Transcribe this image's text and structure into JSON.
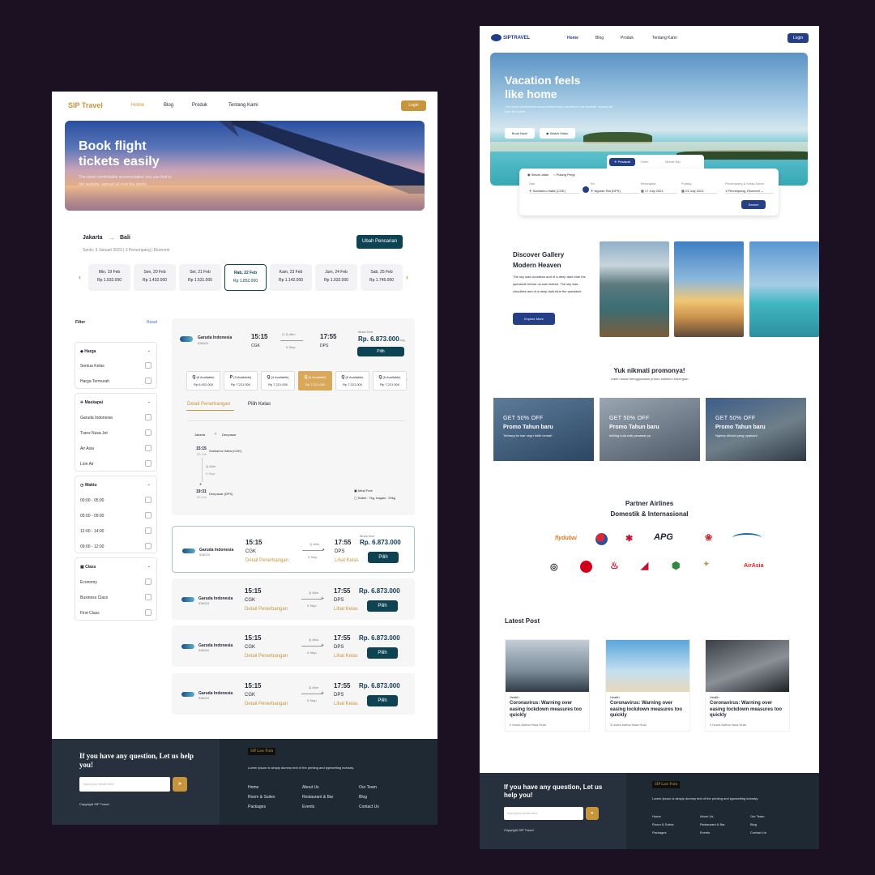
{
  "left": {
    "brand": "SIP Travel",
    "nav": [
      "Home",
      "Blog",
      "Produk",
      "Tentang Kami"
    ],
    "login": "Login",
    "hero_title_1": "Book flight",
    "hero_title_2": "tickets easily",
    "hero_sub_1": "The most comfortable accomodation you can find in",
    "hero_sub_2": "our website, spread all over the world.",
    "route_from": "Jakarta",
    "route_to": "Bali",
    "route_meta": "Senin, 9 Januari 2023  |  3 Penumpang  |  Ekonomi",
    "change_search": "Ubah Pencarian",
    "dates": [
      {
        "day": "Min, 19 Feb",
        "price": "Rp 1.932.000"
      },
      {
        "day": "Sen, 20 Feb",
        "price": "Rp 1.432.000"
      },
      {
        "day": "Sel, 21 Feb",
        "price": "Rp 1.531.000"
      },
      {
        "day": "Rab, 22 Feb",
        "price": "Rp 1.852.000"
      },
      {
        "day": "Kam, 23 Feb",
        "price": "Rp 1.142.000"
      },
      {
        "day": "Jum, 24 Feb",
        "price": "Rp 1.932.000"
      },
      {
        "day": "Sab, 25 Feb",
        "price": "Rp 1.745.000"
      }
    ],
    "filter": "Filter",
    "reset": "Reset",
    "filters": {
      "harga": {
        "title": "Harga",
        "items": [
          "Semua Kelas",
          "Harga Termurah"
        ]
      },
      "maskapai": {
        "title": "Maskapai",
        "items": [
          "Garuda Indonesia",
          "Trans Nusa Jet",
          "Air Asia",
          "Lion Air"
        ]
      },
      "waktu": {
        "title": "Waktu",
        "items": [
          "00:00 - 05:00",
          "05:00 - 09:00",
          "12:00 - 14:00",
          "09:00 - 12:00"
        ]
      },
      "class": {
        "title": "Class",
        "items": [
          "Economy",
          "Business Class",
          "First Class"
        ]
      }
    },
    "flight": {
      "airline": "Garuda Indonesia",
      "code": "ID6024",
      "dep_time": "15:15",
      "dep_code": "CGK",
      "arr_time": "17:55",
      "arr_code": "DPS",
      "duration": "2j 46m",
      "stops": "0 Stop",
      "from_label": "Mulai Dari",
      "price": "Rp. 6.873.000",
      "per": "/org",
      "select": "Pilih",
      "detail": "Detail Penerbangan",
      "class_link": "Lihat Kelas"
    },
    "classes": [
      {
        "code": "Q",
        "avail": "(6 Available)",
        "price": "Rp 6.922.000"
      },
      {
        "code": "P",
        "avail": "(3 Available)",
        "price": "Rp 7.221.000"
      },
      {
        "code": "Q",
        "avail": "(4 Available)",
        "price": "Rp 7.221.000"
      },
      {
        "code": "Q",
        "avail": "(6 Available)",
        "price": "Rp 7.221.000"
      },
      {
        "code": "Q",
        "avail": "(6 Available)",
        "price": "Rp 7.221.000"
      },
      {
        "code": "Q",
        "avail": "(6 Available)",
        "price": "Rp 7.221.000"
      }
    ],
    "tabs": [
      "Detail Penerbangan",
      "Pilih Kelas"
    ],
    "detail": {
      "from_city": "Jakarta",
      "to_city": "Denpasar",
      "dep_time": "15:15",
      "dep_date": "20 Jun",
      "dep_airport": "Soekarno Hatta (CGK)",
      "duration": "2j 46m",
      "stops": "0 Stop",
      "arr_time": "19:31",
      "arr_date": "20 Jun",
      "arr_airport": "Denpasar (DPS)",
      "meal": "Meal Free",
      "baggage": "Kabin : 7kg, bagasi : 20kg"
    },
    "footer": {
      "question": "If you have any question, Let us help you!",
      "email_placeholder": "Input your email here",
      "copyright": "Copyright SIP Travel",
      "logo": "SIP Law Firm",
      "desc": "Lorem Ipsum is simply dummy text of the printing and typesetting industry.",
      "col1": [
        "Home",
        "Room & Suites",
        "Packages"
      ],
      "col2": [
        "About Us",
        "Restaurant & Bar",
        "Events"
      ],
      "col3": [
        "Our Team",
        "Blog",
        "Contact Us"
      ]
    }
  },
  "right": {
    "brand": "SIPTRAVEL",
    "nav": [
      "Home",
      "Blog",
      "Produk",
      "Tentang Kami"
    ],
    "login": "Login",
    "hero_title_1": "Vacation feels",
    "hero_title_2": "like home",
    "hero_sub": "The most comfortable accomodation you can find in our website, spread all over the world.",
    "book_now": "Book Now!",
    "watch": "Watch Video",
    "search_tabs": [
      "Pesawat",
      "Hotel",
      "Mobile Bip"
    ],
    "trip_types": [
      "Sekali Jalan",
      "Pulang Pergi"
    ],
    "fields": {
      "dari": "Dari",
      "dari_val": "Soekarno-Hatta (CGK)",
      "ke": "Ke",
      "ke_val": "Ngurah Rai (DPS)",
      "berangkat": "Berangkat",
      "berangkat_val": "17 July 2021",
      "pulang": "Pulang",
      "pulang_val": "23 July 2021",
      "penumpang": "Penumpang & Kelas Kabin",
      "penumpang_val": "1 Penumpang, Ekonomi"
    },
    "search": "Search",
    "gallery_title_1": "Discover Gallery",
    "gallery_title_2": "Modern Heaven",
    "gallery_text": "The sky was cloudless and of a deep dark blue the spectacle before us was indeed. The sky was cloudless and of a deep dark blue the spectacle.",
    "explore": "Explore More",
    "promo_title": "Yuk nikmati promonya!",
    "promo_sub": "Lebih hemat menggunakan promo sebelum kepergian",
    "promos": [
      {
        "tag": "GET 50% OFF",
        "title": "Promo Tahun baru",
        "text": "Terbang ke luar negri lebih hemat!"
      },
      {
        "tag": "GET 50% OFF",
        "title": "Promo Tahun baru",
        "text": "keliling kota naik pesawat pp"
      },
      {
        "tag": "GET 50% OFF",
        "title": "Promo Tahun baru",
        "text": "Nginep dihotel yang nyaman!"
      }
    ],
    "partner_1": "Partner Airlines",
    "partner_2": "Domestik & Internasional",
    "airlines_row1": [
      "flydubai",
      "Korean Air",
      "Hong Kong Airlines",
      "APG Airlines",
      "China Southern",
      "Garuda"
    ],
    "airlines_row2": [
      "Lufthansa",
      "JAL",
      "Turkish",
      "Air Mauritius",
      "Ethiopian",
      "Etihad",
      "AirAsia"
    ],
    "airline_text_flydubai": "flydubai",
    "airline_text_apg": "APG",
    "airline_text_airasia": "AirAsia",
    "latest": "Latest Post",
    "posts": [
      {
        "tag": "Health",
        "title": "Coronavirus: Warning over easing lockdown measures too quickly",
        "meta": "2 hours     Author Nula Hula"
      },
      {
        "tag": "Health",
        "title": "Coronavirus: Warning over easing lockdown measures too quickly",
        "meta": "3 hours     Author Nula Hula"
      },
      {
        "tag": "Health",
        "title": "Coronavirus: Warning over easing lockdown measures too quickly",
        "meta": "2 hours     Author Nula Hula"
      }
    ],
    "footer": {
      "question": "If you have any question, Let us help you!",
      "email_placeholder": "Input your email here",
      "copyright": "Copyright SIP Travel",
      "logo": "SIP Law Firm",
      "desc": "Lorem Ipsum is simply dummy text of the printing and typesetting industry.",
      "col1": [
        "Home",
        "Room & Suites",
        "Packages"
      ],
      "col2": [
        "About Us",
        "Restaurant & Bar",
        "Events"
      ],
      "col3": [
        "Our Team",
        "Blog",
        "Contact Us"
      ]
    }
  }
}
